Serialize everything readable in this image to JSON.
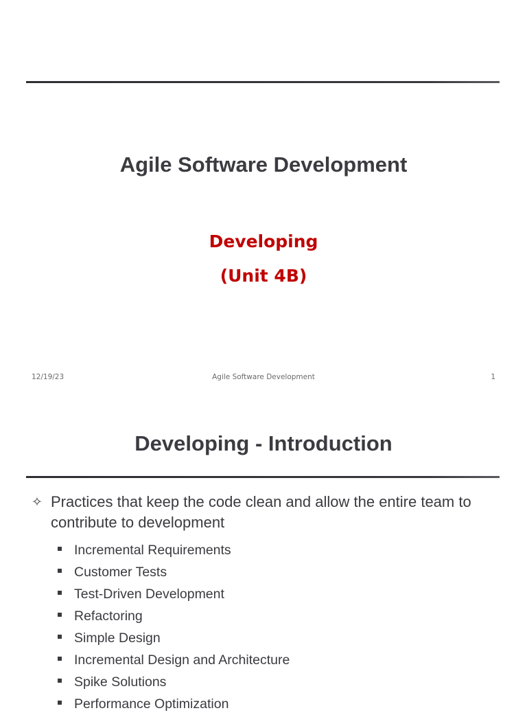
{
  "slide1": {
    "title": "Agile Software Development",
    "subtitle_line1": "Developing",
    "subtitle_line2": "(Unit 4B)",
    "footer": {
      "date": "12/19/23",
      "center": "Agile Software Development",
      "page": "1"
    }
  },
  "slide2": {
    "title": "Developing - Introduction",
    "main_bullet": {
      "icon": "four-pointed-star-outline-icon",
      "text": "Practices that keep the code clean and allow the entire team to contribute to development"
    },
    "sub_bullets": [
      "Incremental Requirements",
      "Customer Tests",
      "Test-Driven Development",
      "Refactoring",
      "Simple Design",
      "Incremental Design and Architecture",
      "Spike Solutions",
      "Performance Optimization"
    ]
  },
  "colors": {
    "title_text": "#3b3b41",
    "subtitle_red": "#c00000",
    "rule": "#2f2f33",
    "footer_text": "#6b6b6b"
  }
}
